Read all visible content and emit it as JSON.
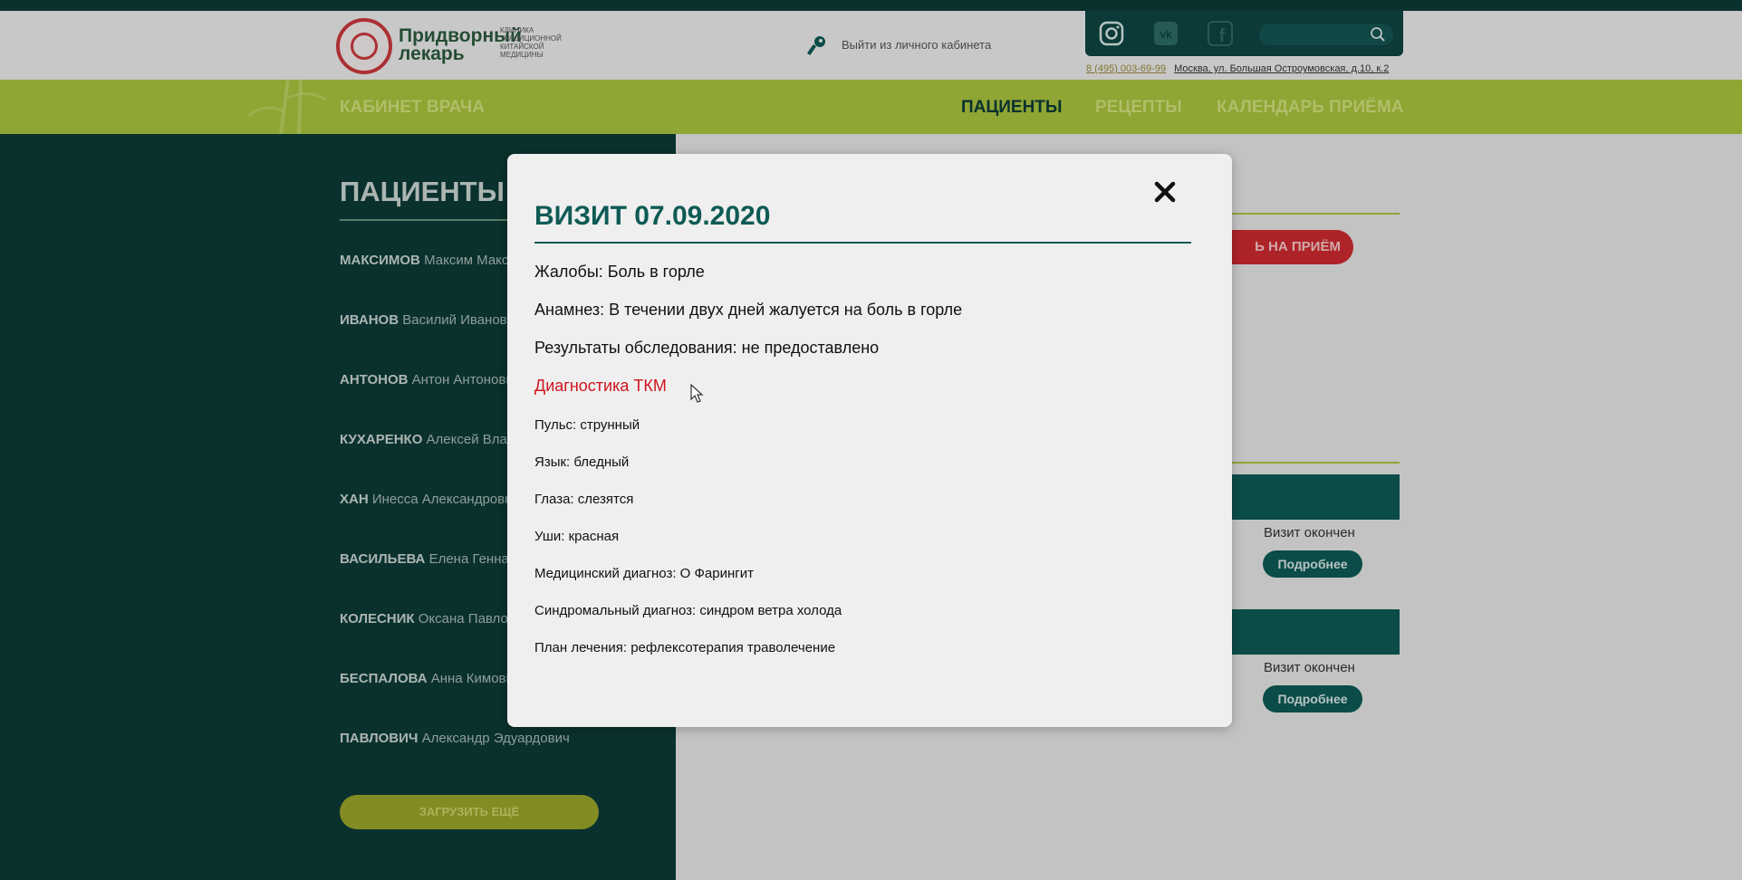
{
  "header": {
    "logo_title_line1": "Придворный",
    "logo_title_line2": "лекарь",
    "logo_sub": "Клиника традиционной китайской медицины",
    "logout": "Выйти из личного кабинета",
    "phone": "8 (495) 003-69-99",
    "address": "Москва, ул. Большая Остроумовская, д.10, к.2"
  },
  "nav": {
    "brand": "КАБИНЕТ ВРАЧА",
    "items": [
      "ПАЦИЕНТЫ",
      "РЕЦЕПТЫ",
      "КАЛЕНДАРЬ ПРИЁМА"
    ]
  },
  "sidebar": {
    "title": "ПАЦИЕНТЫ",
    "patients": [
      {
        "last": "МАКСИМОВ",
        "rest": "Максим Максимович"
      },
      {
        "last": "ИВАНОВ",
        "rest": "Василий Иванович"
      },
      {
        "last": "АНТОНОВ",
        "rest": "Антон Антонович"
      },
      {
        "last": "КУХАРЕНКО",
        "rest": "Алексей Владимирович"
      },
      {
        "last": "ХАН",
        "rest": "Инесса Александровна"
      },
      {
        "last": "ВАСИЛЬЕВА",
        "rest": "Елена Геннадьевна"
      },
      {
        "last": "КОЛЕСНИК",
        "rest": "Оксана Павловна"
      },
      {
        "last": "БЕСПАЛОВА",
        "rest": "Анна Кимовна"
      },
      {
        "last": "ПАВЛОВИЧ",
        "rest": "Александр Эдуардович"
      }
    ],
    "load_more": "ЗАГРУЗИТЬ ЕЩЁ"
  },
  "content": {
    "record_button": "Ь НА ПРИЁМ",
    "visits": [
      {
        "status": "Визит окончен",
        "button": "Подробнее"
      },
      {
        "status": "Визит окончен",
        "button": "Подробнее"
      }
    ]
  },
  "modal": {
    "title": "ВИЗИТ 07.09.2020",
    "complaints": "Жалобы: Боль в горле",
    "anamnesis": "Анамнез: В течении двух дней жалуется на боль в горле",
    "results": "Результаты обследования: не предоставлено",
    "tcm_heading": "Диагностика ТКМ",
    "pulse": "Пульс: струнный",
    "tongue": "Язык: бледный",
    "eyes": "Глаза: слезятся",
    "ears": "Уши: красная",
    "medical_diagnosis": "Медицинский диагноз: О Фарингит",
    "syndrome_diagnosis": "Синдромальный диагноз: синдром ветра холода",
    "treatment_plan": "План лечения: рефлексотерапия траволечение"
  },
  "colors": {
    "dark_teal": "#0c3a36",
    "accent_green": "#a8c23e",
    "brand_teal": "#0e5a55",
    "alert_red": "#d0141e"
  },
  "icons": [
    "key-icon",
    "instagram-icon",
    "vk-icon",
    "facebook-icon",
    "search-icon",
    "close-icon",
    "cursor-icon"
  ]
}
